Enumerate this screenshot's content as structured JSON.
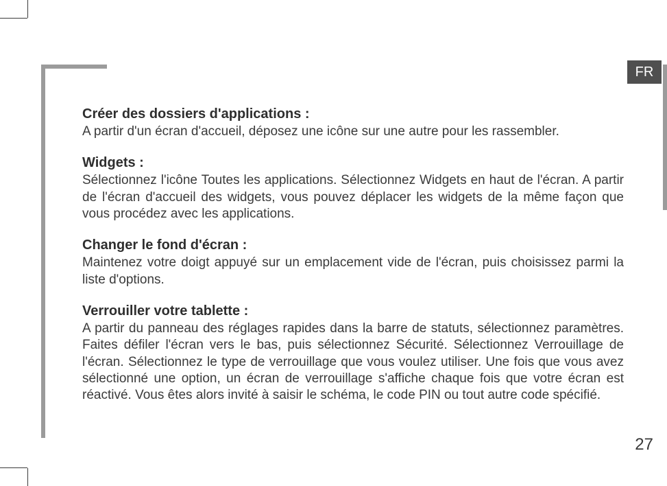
{
  "language_tab": "FR",
  "page_number": "27",
  "sections": [
    {
      "heading": "Créer des dossiers d'applications :",
      "body": "A partir d'un écran d'accueil, déposez une icône sur une autre pour les rassembler."
    },
    {
      "heading": "Widgets :",
      "body": "Sélectionnez l'icône Toutes les applications. Sélectionnez Widgets en haut de l'écran. A partir de l'écran d'accueil des widgets, vous pouvez déplacer les widgets de la même façon que vous procédez avec les applications."
    },
    {
      "heading": "Changer le fond d'écran :",
      "body": "Maintenez votre doigt appuyé sur un emplacement vide de l'écran, puis choisissez parmi la liste d'options."
    },
    {
      "heading": "Verrouiller votre tablette :",
      "body": "A partir du panneau des réglages rapides dans la barre de statuts, sélectionnez paramètres.  Faites défiler l'écran vers le bas, puis sélectionnez Sécurité. Sélectionnez Verrouillage de l'écran. Sélectionnez le type de verrouillage que vous voulez utiliser. Une fois que vous avez sélectionné une option, un écran de verrouillage s'affiche chaque fois que votre écran est réactivé. Vous êtes alors invité à saisir le schéma, le code PIN ou tout autre code spécifié."
    }
  ]
}
